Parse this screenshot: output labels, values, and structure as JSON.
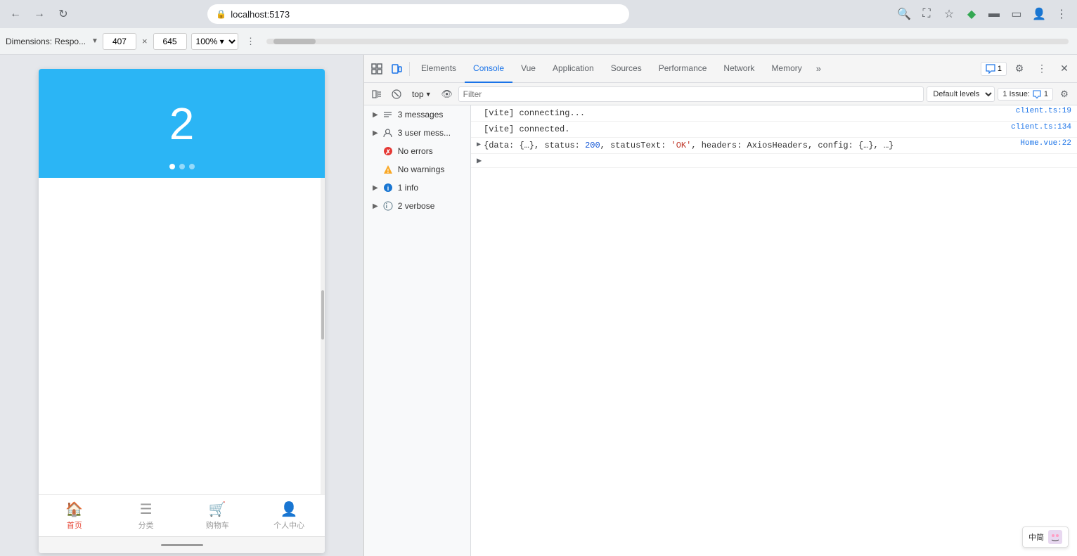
{
  "browser": {
    "url": "localhost:5173",
    "back_btn": "←",
    "forward_btn": "→",
    "refresh_btn": "↺"
  },
  "toolbar": {
    "dimensions_label": "Dimensions: Respo...",
    "width_value": "407",
    "height_value": "645",
    "zoom_value": "100%",
    "more_label": "⋮"
  },
  "mobile": {
    "banner_number": "2",
    "nav_items": [
      {
        "label": "首页",
        "active": true
      },
      {
        "label": "分类",
        "active": false
      },
      {
        "label": "购物车",
        "active": false
      },
      {
        "label": "个人中心",
        "active": false
      }
    ]
  },
  "devtools": {
    "tabs": [
      {
        "label": "Elements",
        "active": false
      },
      {
        "label": "Console",
        "active": true
      },
      {
        "label": "Vue",
        "active": false
      },
      {
        "label": "Application",
        "active": false
      },
      {
        "label": "Sources",
        "active": false
      },
      {
        "label": "Performance",
        "active": false
      },
      {
        "label": "Network",
        "active": false
      },
      {
        "label": "Memory",
        "active": false
      }
    ],
    "issues_badge": "1",
    "console": {
      "top_selector": "top",
      "filter_placeholder": "Filter",
      "level_label": "Default levels",
      "issues_label": "1 Issue: ",
      "issues_count": "1",
      "sidebar_items": [
        {
          "label": "3 messages",
          "type": "messages",
          "has_arrow": true
        },
        {
          "label": "3 user mess...",
          "type": "user",
          "has_arrow": true
        },
        {
          "label": "No errors",
          "type": "error",
          "has_arrow": false
        },
        {
          "label": "No warnings",
          "type": "warning",
          "has_arrow": false
        },
        {
          "label": "1 info",
          "type": "info",
          "has_arrow": true
        },
        {
          "label": "2 verbose",
          "type": "verbose",
          "has_arrow": true
        }
      ],
      "log_entries": [
        {
          "text": "[vite] connecting...",
          "link": "client.ts:19",
          "expandable": false,
          "indent": false
        },
        {
          "text": "[vite] connected.",
          "link": "client.ts:134",
          "expandable": false,
          "indent": false
        },
        {
          "text": "▶ {data: {…}, status: 200, statusText: 'OK', headers: AxiosHeaders, config: {…}, …}",
          "link": "Home.vue:22",
          "expandable": true,
          "indent": false
        }
      ]
    }
  }
}
